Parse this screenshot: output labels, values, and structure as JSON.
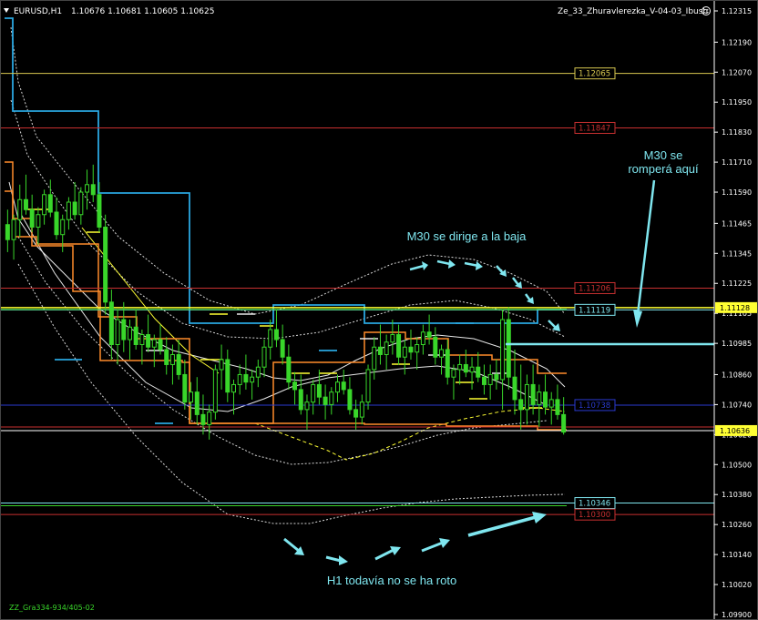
{
  "header": {
    "symbol": "EURUSD,H1",
    "ohlc": "1.10676 1.10681 1.10605 1.10625",
    "indicator": "Ze_33_Zhuravlerezka_V-04-03_Ibush",
    "footer_tag": "ZZ_Gra334-934/405-02"
  },
  "annotations": {
    "m30_break_line1": "M30 se",
    "m30_break_line2": "romperá aquí",
    "m30_down": "M30 se dirige a la  baja",
    "h1_not_broken": "H1 todavía no se ha roto"
  },
  "colors": {
    "background": "#000000",
    "candle": "#39d62a",
    "annotation": "#7fe6ef",
    "orange_channel": "#ff8c2a",
    "blue_channel": "#2aa7e0",
    "dotted_bands": "#d8d8d8",
    "yellow_line": "#ffff33",
    "red_line": "#c83030",
    "navy_line": "#2a3ad0",
    "cyan_line": "#7fe6ef"
  },
  "chart_data": {
    "type": "candlestick",
    "symbol": "EURUSD",
    "timeframe": "H1",
    "ylim": [
      1.099,
      1.12315
    ],
    "y_ticks": [
      "1.12315",
      "1.12190",
      "1.12070",
      "1.11950",
      "1.11830",
      "1.11710",
      "1.11590",
      "1.11465",
      "1.11345",
      "1.11225",
      "1.11105",
      "1.10985",
      "1.10860",
      "1.10740",
      "1.10620",
      "1.10500",
      "1.10380",
      "1.10260",
      "1.10140",
      "1.10020",
      "1.09900"
    ],
    "current_price": 1.10636,
    "current_price_label": "1.10636",
    "levels": [
      {
        "label": "1.12065",
        "value": 1.12065,
        "color": "#d8c850"
      },
      {
        "label": "1.11847",
        "value": 1.11847,
        "color": "#c83030"
      },
      {
        "label": "1.11206",
        "value": 1.11206,
        "color": "#c83030"
      },
      {
        "label": "1.11128",
        "value": 1.11128,
        "color": "#ffff33",
        "highlight": true
      },
      {
        "label": "1.11119",
        "value": 1.11119,
        "color": "#7fe6ef"
      },
      {
        "label": "1.10738",
        "value": 1.10738,
        "color": "#2a3ad0"
      },
      {
        "label": "1.10346",
        "value": 1.10346,
        "color": "#7fe6ef"
      },
      {
        "label": "1.10300",
        "value": 1.103,
        "color": "#c83030"
      }
    ],
    "candles": [
      [
        1.1146,
        1.1152,
        1.1135,
        1.114
      ],
      [
        1.114,
        1.115,
        1.1132,
        1.1148
      ],
      [
        1.1148,
        1.1162,
        1.1141,
        1.1156
      ],
      [
        1.1156,
        1.1166,
        1.115,
        1.1152
      ],
      [
        1.1152,
        1.1158,
        1.1143,
        1.1145
      ],
      [
        1.1145,
        1.1153,
        1.1138,
        1.115
      ],
      [
        1.115,
        1.116,
        1.1146,
        1.1158
      ],
      [
        1.1158,
        1.1164,
        1.1149,
        1.1151
      ],
      [
        1.1151,
        1.1157,
        1.114,
        1.1142
      ],
      [
        1.1142,
        1.115,
        1.1135,
        1.1148
      ],
      [
        1.1148,
        1.1157,
        1.1144,
        1.1155
      ],
      [
        1.1155,
        1.1163,
        1.1148,
        1.115
      ],
      [
        1.115,
        1.1161,
        1.1146,
        1.1159
      ],
      [
        1.1159,
        1.1168,
        1.1152,
        1.1162
      ],
      [
        1.1162,
        1.117,
        1.1155,
        1.1158
      ],
      [
        1.1158,
        1.1163,
        1.1143,
        1.1145
      ],
      [
        1.1145,
        1.115,
        1.111,
        1.1115
      ],
      [
        1.1115,
        1.112,
        1.1092,
        1.1098
      ],
      [
        1.1098,
        1.1112,
        1.109,
        1.1108
      ],
      [
        1.1108,
        1.1115,
        1.1095,
        1.11
      ],
      [
        1.11,
        1.1108,
        1.1092,
        1.1105
      ],
      [
        1.1105,
        1.1112,
        1.1096,
        1.1098
      ],
      [
        1.1098,
        1.1104,
        1.109,
        1.1102
      ],
      [
        1.1102,
        1.111,
        1.1095,
        1.1097
      ],
      [
        1.1097,
        1.1102,
        1.1089,
        1.11
      ],
      [
        1.11,
        1.1106,
        1.1094,
        1.1096
      ],
      [
        1.1096,
        1.1101,
        1.1086,
        1.109
      ],
      [
        1.109,
        1.1098,
        1.1082,
        1.1094
      ],
      [
        1.1094,
        1.11,
        1.1084,
        1.1086
      ],
      [
        1.1086,
        1.1092,
        1.1072,
        1.1075
      ],
      [
        1.1075,
        1.1083,
        1.1068,
        1.1079
      ],
      [
        1.1079,
        1.1085,
        1.1066,
        1.107
      ],
      [
        1.107,
        1.1078,
        1.1062,
        1.1066
      ],
      [
        1.1066,
        1.1074,
        1.106,
        1.1071
      ],
      [
        1.1071,
        1.109,
        1.1068,
        1.1088
      ],
      [
        1.1088,
        1.1098,
        1.108,
        1.1092
      ],
      [
        1.1092,
        1.1096,
        1.1075,
        1.1079
      ],
      [
        1.1079,
        1.1084,
        1.107,
        1.1082
      ],
      [
        1.1082,
        1.109,
        1.1078,
        1.1086
      ],
      [
        1.1086,
        1.1094,
        1.108,
        1.1083
      ],
      [
        1.1083,
        1.1088,
        1.1076,
        1.1085
      ],
      [
        1.1085,
        1.1092,
        1.1081,
        1.1089
      ],
      [
        1.1089,
        1.11,
        1.1085,
        1.1097
      ],
      [
        1.1097,
        1.1108,
        1.1092,
        1.1104
      ],
      [
        1.1104,
        1.1112,
        1.1097,
        1.11
      ],
      [
        1.11,
        1.1106,
        1.109,
        1.1093
      ],
      [
        1.1093,
        1.1098,
        1.108,
        1.1083
      ],
      [
        1.1083,
        1.1087,
        1.1074,
        1.108
      ],
      [
        1.108,
        1.1086,
        1.107,
        1.1072
      ],
      [
        1.1072,
        1.1078,
        1.1064,
        1.1075
      ],
      [
        1.1075,
        1.1084,
        1.107,
        1.1082
      ],
      [
        1.1082,
        1.1088,
        1.1074,
        1.1077
      ],
      [
        1.1077,
        1.1082,
        1.1068,
        1.1074
      ],
      [
        1.1074,
        1.1081,
        1.107,
        1.1079
      ],
      [
        1.1079,
        1.1086,
        1.1075,
        1.1083
      ],
      [
        1.1083,
        1.1088,
        1.1078,
        1.108
      ],
      [
        1.108,
        1.1085,
        1.107,
        1.1072
      ],
      [
        1.1072,
        1.1076,
        1.1064,
        1.1069
      ],
      [
        1.1069,
        1.1078,
        1.1066,
        1.1075
      ],
      [
        1.1075,
        1.109,
        1.1072,
        1.1088
      ],
      [
        1.1088,
        1.1101,
        1.1084,
        1.1097
      ],
      [
        1.1097,
        1.1106,
        1.109,
        1.1094
      ],
      [
        1.1094,
        1.1102,
        1.1088,
        1.1099
      ],
      [
        1.1099,
        1.1108,
        1.1094,
        1.1102
      ],
      [
        1.1102,
        1.1106,
        1.109,
        1.1093
      ],
      [
        1.1093,
        1.11,
        1.1086,
        1.1097
      ],
      [
        1.1097,
        1.1104,
        1.1092,
        1.1095
      ],
      [
        1.1095,
        1.1101,
        1.1088,
        1.1098
      ],
      [
        1.1098,
        1.1106,
        1.1094,
        1.1103
      ],
      [
        1.1103,
        1.111,
        1.1098,
        1.1101
      ],
      [
        1.1101,
        1.1105,
        1.109,
        1.1093
      ],
      [
        1.1093,
        1.1098,
        1.1086,
        1.1096
      ],
      [
        1.1096,
        1.11,
        1.1082,
        1.1085
      ],
      [
        1.1085,
        1.109,
        1.1076,
        1.1088
      ],
      [
        1.1088,
        1.1094,
        1.1082,
        1.109
      ],
      [
        1.109,
        1.1096,
        1.1085,
        1.1087
      ],
      [
        1.1087,
        1.1093,
        1.108,
        1.1089
      ],
      [
        1.1089,
        1.1095,
        1.1083,
        1.1085
      ],
      [
        1.1085,
        1.109,
        1.1078,
        1.1082
      ],
      [
        1.1082,
        1.109,
        1.1076,
        1.1086
      ],
      [
        1.1086,
        1.1092,
        1.108,
        1.1084
      ],
      [
        1.1084,
        1.1112,
        1.1072,
        1.1108
      ],
      [
        1.1108,
        1.1113,
        1.108,
        1.1085
      ],
      [
        1.1085,
        1.1096,
        1.107,
        1.1076
      ],
      [
        1.1076,
        1.109,
        1.1064,
        1.1072
      ],
      [
        1.1072,
        1.1086,
        1.1066,
        1.1082
      ],
      [
        1.1082,
        1.109,
        1.107,
        1.1074
      ],
      [
        1.1074,
        1.1082,
        1.1065,
        1.1079
      ],
      [
        1.1079,
        1.1086,
        1.107,
        1.1073
      ],
      [
        1.1073,
        1.1079,
        1.1066,
        1.1076
      ],
      [
        1.1076,
        1.1082,
        1.1068,
        1.107
      ],
      [
        1.107,
        1.1077,
        1.1062,
        1.1063
      ]
    ]
  }
}
